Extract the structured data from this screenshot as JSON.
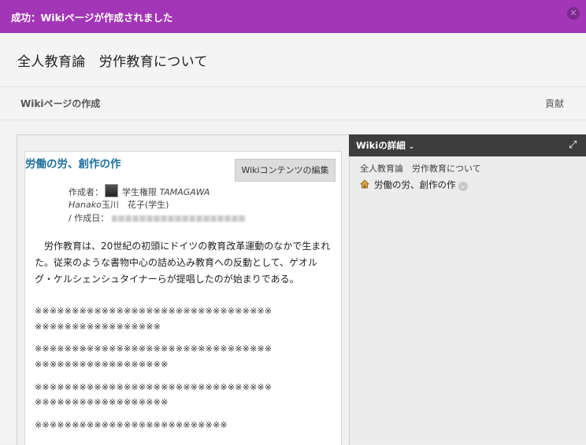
{
  "banner": {
    "message": "成功：Wikiページが作成されました"
  },
  "page": {
    "title": "全人教育論　労作教育について"
  },
  "subbar": {
    "left": "Wikiページの作成",
    "right": "貢献"
  },
  "wiki": {
    "title": "労働の労、創作の作",
    "edit_label": "Wikiコンテンツの編集",
    "author_label": "作成者：",
    "author_name": "学生権限",
    "author_name_italic": "TAMAGAWA",
    "author_line2_italic": "Hanako",
    "author_line2": "玉川　花子(学生)",
    "created_label": "/ 作成日：",
    "body": "労作教育は、20世紀の初頭にドイツの教育改革運動のなかで生まれた。従来のような書物中心の詰め込み教育への反動として、ゲオルグ・ケルシェンシュタイナーらが提唱したのが始まりである。",
    "xlines": [
      "※※※※※※※※※※※※※※※※※※※※※※※※※※※※※※※※",
      "※※※※※※※※※※※※※※※※※",
      "※※※※※※※※※※※※※※※※※※※※※※※※※※※※※※※※",
      "※※※※※※※※※※※※※※※※※※",
      "※※※※※※※※※※※※※※※※※※※※※※※※※※※※※※※※",
      "※※※※※※※※※※※※※※※※※※",
      "※※※※※※※※※※※※※※※※※※※※※※※※※※"
    ]
  },
  "side": {
    "header": "Wikiの詳細",
    "breadcrumb": "全人教育論　労作教育について",
    "tree_item": "労働の労、創作の作"
  },
  "icons": {
    "close": "close-icon",
    "expand": "expand-icon",
    "home": "home-icon",
    "dropdown": "chevron-down-icon"
  },
  "colors": {
    "banner": "#a336b7",
    "link": "#1f6fa0",
    "side_header": "#3d3d3d"
  }
}
